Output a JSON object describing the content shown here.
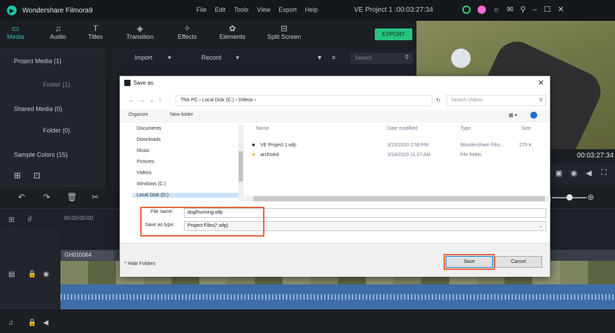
{
  "titlebar": {
    "app_name": "Wondershare Filmora9",
    "menu": [
      "File",
      "Edit",
      "Tools",
      "View",
      "Export",
      "Help"
    ],
    "project_title": "VE Project 1 :00:03:27:34"
  },
  "toolbar": {
    "tools": [
      "Media",
      "Audio",
      "Titles",
      "Transition",
      "Effects",
      "Elements",
      "Split Screen"
    ],
    "export_label": "EXPORT"
  },
  "sidebar": {
    "items": [
      "Project Media (1)",
      "Folder (1)",
      "Shared Media (0)",
      "Folder (0)",
      "Sample Colors (15)"
    ]
  },
  "media_header": {
    "import_label": "Import",
    "record_label": "Record",
    "search_placeholder": "Search"
  },
  "preview": {
    "timecode": "00:03:27:34"
  },
  "timeline": {
    "ruler_start": "00:00:00:00",
    "clip_label": "GH010064"
  },
  "dialog": {
    "title": "Save as",
    "address": "This PC  ›  Local Disk (C:)  ›  Videos  ›",
    "search_placeholder": "Search Videos",
    "organize_label": "Organize",
    "new_folder_label": "New folder",
    "nav_items": [
      "Documents",
      "Downloads",
      "Music",
      "Pictures",
      "Videos",
      "Windows (C:)",
      "Local Disk (D:)"
    ],
    "columns": [
      "Name",
      "Date modified",
      "Type",
      "Size"
    ],
    "files": [
      {
        "name": "VE Project 1.wfp",
        "date": "3/13/2020 2:58 PM",
        "type": "Wondershare Film...",
        "size": "279 K"
      },
      {
        "name": "archived",
        "date": "3/18/2020 11:27 AM",
        "type": "File folder",
        "size": ""
      }
    ],
    "file_name_label": "File name:",
    "file_name_value": "dogRunning.wfp",
    "save_type_label": "Save as type:",
    "save_type_value": "Project Files(*.wfp)",
    "hide_folders_label": "Hide Folders",
    "save_label": "Save",
    "cancel_label": "Cancel"
  }
}
